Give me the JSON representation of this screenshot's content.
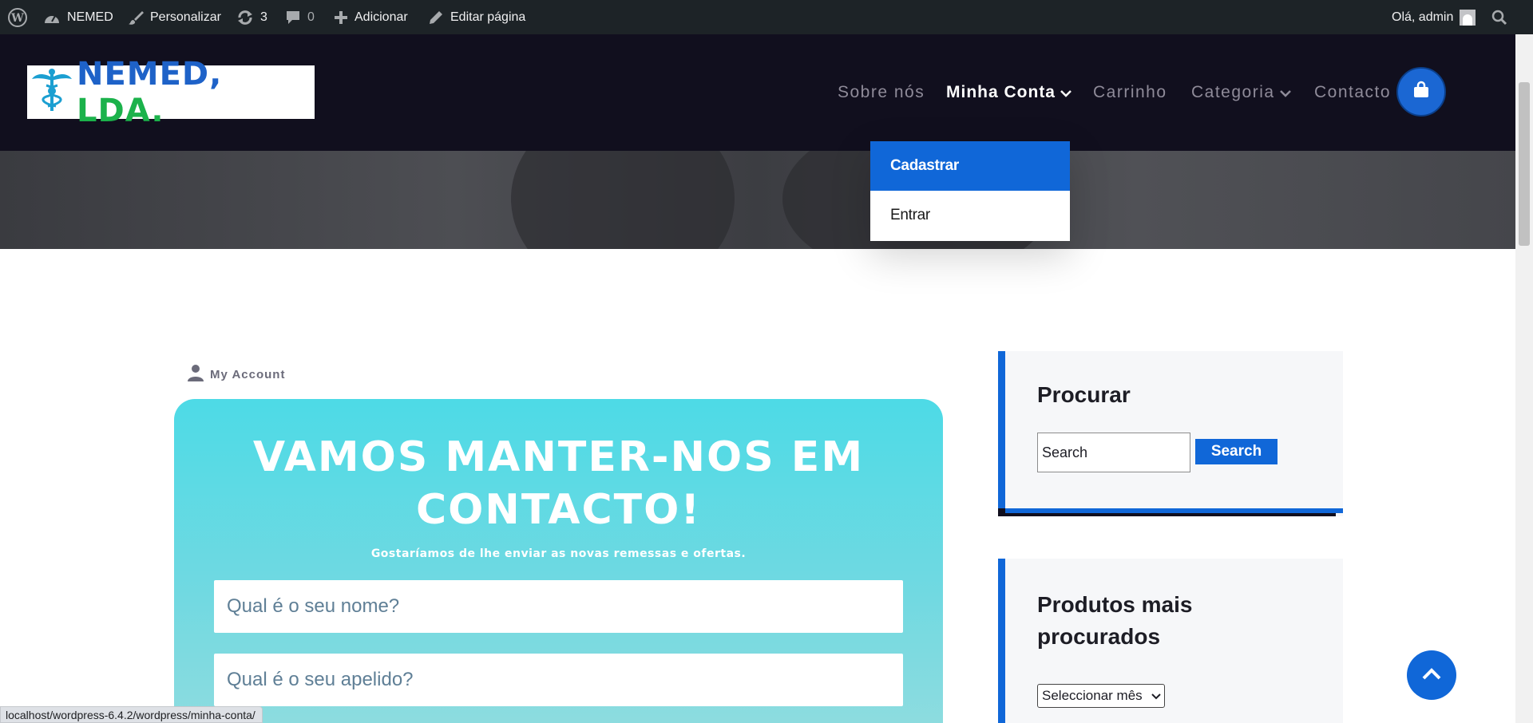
{
  "admin_bar": {
    "site_name": "NEMED",
    "customize": "Personalizar",
    "updates_count": "3",
    "comments_count": "0",
    "add_new": "Adicionar",
    "edit_page": "Editar página",
    "greeting": "Olá, admin"
  },
  "header": {
    "logo_text": "NEMED,",
    "logo_text_2": "LDA.",
    "nav": [
      "Sobre nós",
      "Minha Conta",
      "Carrinho",
      "Categoria",
      "Contacto"
    ],
    "active_nav": "Minha Conta",
    "dropdown": [
      "Cadastrar",
      "Entrar"
    ]
  },
  "breadcrumb": {
    "label": "My Account"
  },
  "contact": {
    "title_line1": "VAMOS MANTER-NOS EM",
    "title_line2": "CONTACTO!",
    "subtitle": "Gostaríamos de lhe enviar as novas remessas e ofertas.",
    "name_placeholder": "Qual é o seu nome?",
    "surname_placeholder": "Qual é o seu apelido?"
  },
  "sidebar": {
    "search_title": "Procurar",
    "search_placeholder": "Search",
    "search_button": "Search",
    "popular_title_line1": "Produtos mais",
    "popular_title_line2": "procurados",
    "month_select": "Seleccionar mês"
  },
  "status_url": "localhost/wordpress-6.4.2/wordpress/minha-conta/",
  "colors": {
    "accent": "#1067d8",
    "header_bg": "#110f1e",
    "admin_bar_bg": "#1d2327",
    "contact_bg": "#4ddae6"
  }
}
